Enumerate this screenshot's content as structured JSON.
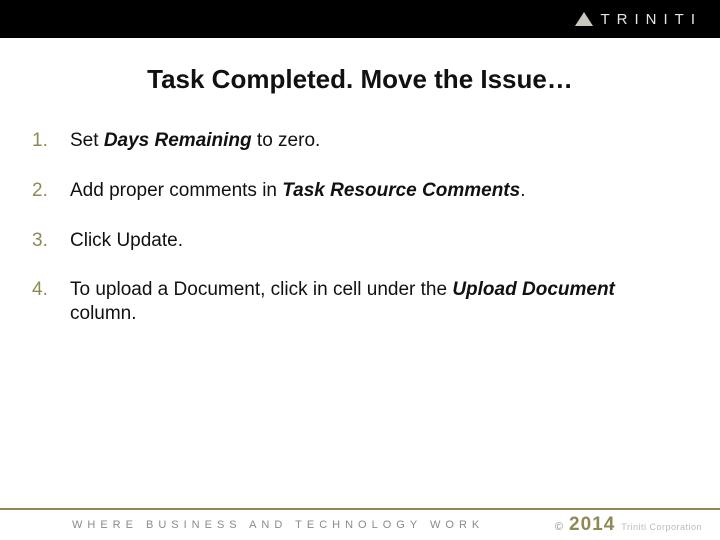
{
  "brand": {
    "name": "TRINITI",
    "icon": "triangle-icon"
  },
  "title": "Task Completed. Move the Issue…",
  "steps": [
    {
      "pre": "Set ",
      "em": "Days Remaining",
      "post": " to zero."
    },
    {
      "pre": "Add proper comments in ",
      "em": "Task Resource Comments",
      "post": "."
    },
    {
      "pre": "Click Update.",
      "em": "",
      "post": ""
    },
    {
      "pre": "To upload a Document, click in cell under the ",
      "em": "Upload Document",
      "post": " column."
    }
  ],
  "footer": {
    "tagline": "WHERE BUSINESS AND TECHNOLOGY WORK",
    "copyright_symbol": "©",
    "year": "2014",
    "corp": "Triniti Corporation"
  }
}
